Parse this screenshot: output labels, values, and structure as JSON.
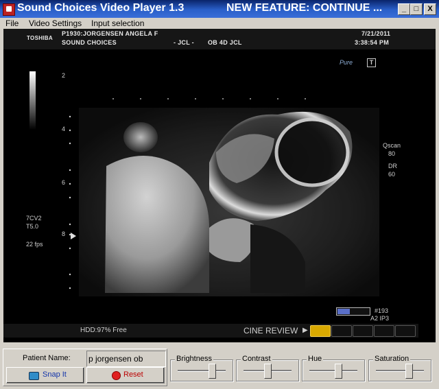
{
  "window": {
    "title": "Sound Choices Video Player 1.3",
    "title_right": "NEW FEATURE:  CONTINUE ...",
    "minimize_label": "_",
    "maximize_label": "□",
    "close_label": "X"
  },
  "menu": [
    "File",
    "Video Settings",
    "Input selection"
  ],
  "video": {
    "brand": "TOSHIBA",
    "patient_line": "P1930:JORGENSEN ANGELA     F",
    "clinic_line": "SOUND CHOICES",
    "jcl": "- JCL -",
    "study": "OB 4D JCL",
    "date": "7/21/2011",
    "time": "3:38:54 PM",
    "depth_marks": [
      "2",
      "4",
      "6",
      "8"
    ],
    "probe": "7CV2",
    "probe_sub": "T5.0",
    "fps": "22 fps",
    "logo": "Pure",
    "t_badge": "T",
    "qscan_label": "Qscan",
    "qscan_value": "80",
    "dr_label": "DR",
    "dr_value": "60",
    "frame_number": "#193",
    "frame_sub": "A2  IP3",
    "hdd": "HDD:97% Free",
    "cine_review": "CINE REVIEW"
  },
  "controls": {
    "patient_label": "Patient Name:",
    "patient_value": "p jorgensen ob",
    "snap_label": "Snap It",
    "reset_label": "Reset",
    "sliders": [
      {
        "label": "Brightness",
        "value": 0.72
      },
      {
        "label": "Contrast",
        "value": 0.5
      },
      {
        "label": "Hue",
        "value": 0.6
      },
      {
        "label": "Saturation",
        "value": 0.68
      }
    ]
  }
}
